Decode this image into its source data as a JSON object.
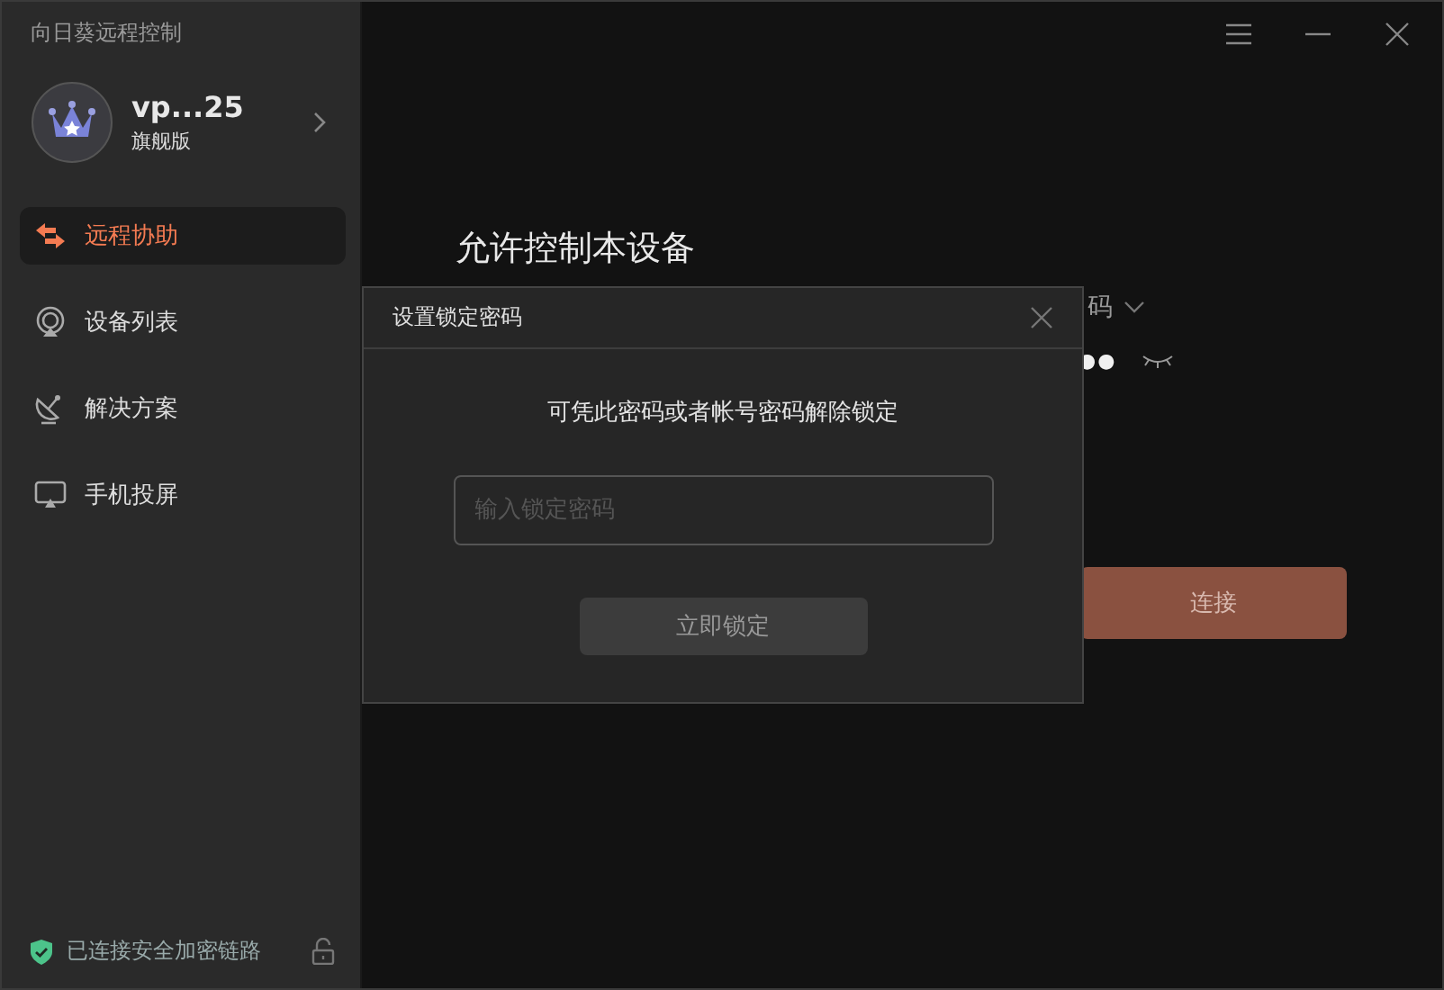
{
  "window": {
    "title": "向日葵远程控制"
  },
  "account": {
    "name": "vp...25",
    "edition": "旗舰版"
  },
  "nav": [
    {
      "kind": "remote",
      "label": "远程协助",
      "selected": true
    },
    {
      "kind": "devices",
      "label": "设备列表",
      "selected": false
    },
    {
      "kind": "solutions",
      "label": "解决方案",
      "selected": false
    },
    {
      "kind": "screen",
      "label": "手机投屏",
      "selected": false
    }
  ],
  "status": {
    "text": "已连接安全加密链路"
  },
  "main": {
    "title": "允许控制本设备",
    "code_label_fragment": "码",
    "password_dots": "●●",
    "connect_button": "连接"
  },
  "dialog": {
    "title": "设置锁定密码",
    "message": "可凭此密码或者帐号密码解除锁定",
    "input": {
      "placeholder": "输入锁定密码"
    },
    "button": "立即锁定"
  }
}
